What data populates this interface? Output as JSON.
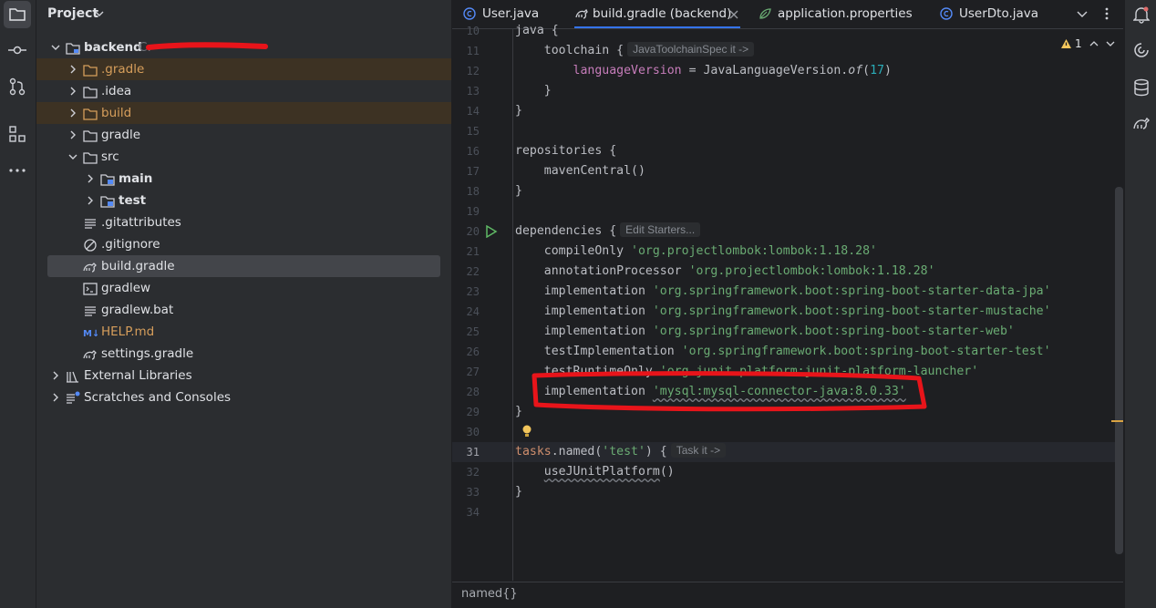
{
  "left_toolbar": {
    "items": [
      "project-icon",
      "commit-icon",
      "git-branch-icon",
      "structure-icon",
      "more-icon"
    ]
  },
  "project_panel": {
    "title": "Project",
    "tree": [
      {
        "label": "backend",
        "path_hint": "C:",
        "level": 0,
        "expanded": true,
        "icon": "module-folder-icon",
        "style": "bold"
      },
      {
        "label": ".gradle",
        "level": 1,
        "expanded": false,
        "icon": "folder-icon",
        "style": "orange"
      },
      {
        "label": ".idea",
        "level": 1,
        "expanded": false,
        "icon": "folder-icon",
        "style": "normal"
      },
      {
        "label": "build",
        "level": 1,
        "expanded": false,
        "icon": "folder-icon",
        "style": "orange"
      },
      {
        "label": "gradle",
        "level": 1,
        "expanded": false,
        "icon": "folder-icon",
        "style": "normal"
      },
      {
        "label": "src",
        "level": 1,
        "expanded": true,
        "icon": "folder-icon",
        "style": "normal"
      },
      {
        "label": "main",
        "level": 2,
        "expanded": false,
        "icon": "source-folder-icon",
        "style": "bold"
      },
      {
        "label": "test",
        "level": 2,
        "expanded": false,
        "icon": "source-folder-icon",
        "style": "bold"
      },
      {
        "label": ".gitattributes",
        "level": 1,
        "icon": "text-file-icon",
        "style": "normal"
      },
      {
        "label": ".gitignore",
        "level": 1,
        "icon": "ignore-file-icon",
        "style": "normal"
      },
      {
        "label": "build.gradle",
        "level": 1,
        "icon": "gradle-icon",
        "style": "normal",
        "selected": true
      },
      {
        "label": "gradlew",
        "level": 1,
        "icon": "shell-icon",
        "style": "normal"
      },
      {
        "label": "gradlew.bat",
        "level": 1,
        "icon": "text-file-icon",
        "style": "normal"
      },
      {
        "label": "HELP.md",
        "level": 1,
        "icon": "markdown-icon",
        "style": "orange"
      },
      {
        "label": "settings.gradle",
        "level": 1,
        "icon": "gradle-icon",
        "style": "normal"
      },
      {
        "label": "External Libraries",
        "level": 0,
        "expanded": false,
        "icon": "library-icon",
        "style": "normal"
      },
      {
        "label": "Scratches and Consoles",
        "level": 0,
        "expanded": false,
        "icon": "scratches-icon",
        "style": "normal"
      }
    ]
  },
  "tabs": [
    {
      "label": "User.java",
      "icon": "class-icon"
    },
    {
      "label": "build.gradle (backend)",
      "icon": "gradle-icon",
      "active": true
    },
    {
      "label": "application.properties",
      "icon": "spring-icon"
    },
    {
      "label": "UserDto.java",
      "icon": "class-icon"
    }
  ],
  "inspection": {
    "warnings": "1"
  },
  "editor": {
    "lines": [
      {
        "n": "10",
        "tokens": [
          {
            "t": "java {",
            "c": "fn"
          }
        ]
      },
      {
        "n": "11",
        "tokens": [
          {
            "t": "    toolchain {",
            "c": "fn"
          },
          {
            "hint": "JavaToolchainSpec it ->"
          }
        ]
      },
      {
        "n": "12",
        "tokens": [
          {
            "t": "        ",
            "c": "fn"
          },
          {
            "t": "languageVersion",
            "c": "prop"
          },
          {
            "t": " = JavaLanguageVersion.",
            "c": "fn"
          },
          {
            "t": "of",
            "c": "fn ital"
          },
          {
            "t": "(",
            "c": "fn"
          },
          {
            "t": "17",
            "c": "num"
          },
          {
            "t": ")",
            "c": "fn"
          }
        ]
      },
      {
        "n": "13",
        "tokens": [
          {
            "t": "    }",
            "c": "fn"
          }
        ]
      },
      {
        "n": "14",
        "tokens": [
          {
            "t": "}",
            "c": "fn"
          }
        ]
      },
      {
        "n": "15",
        "tokens": []
      },
      {
        "n": "16",
        "tokens": [
          {
            "t": "repositories {",
            "c": "fn"
          }
        ]
      },
      {
        "n": "17",
        "tokens": [
          {
            "t": "    mavenCentral()",
            "c": "fn"
          }
        ]
      },
      {
        "n": "18",
        "tokens": [
          {
            "t": "}",
            "c": "fn"
          }
        ]
      },
      {
        "n": "19",
        "tokens": []
      },
      {
        "n": "20",
        "run": true,
        "tokens": [
          {
            "t": "dependencies {",
            "c": "fn"
          },
          {
            "hint": "Edit Starters..."
          }
        ]
      },
      {
        "n": "21",
        "tokens": [
          {
            "t": "    compileOnly ",
            "c": "fn"
          },
          {
            "t": "'org.projectlombok:lombok:1.18.28'",
            "c": "str"
          }
        ]
      },
      {
        "n": "22",
        "tokens": [
          {
            "t": "    annotationProcessor ",
            "c": "fn"
          },
          {
            "t": "'org.projectlombok:lombok:1.18.28'",
            "c": "str"
          }
        ]
      },
      {
        "n": "23",
        "tokens": [
          {
            "t": "    implementation ",
            "c": "fn"
          },
          {
            "t": "'org.springframework.boot:spring-boot-starter-data-jpa'",
            "c": "str"
          }
        ]
      },
      {
        "n": "24",
        "tokens": [
          {
            "t": "    implementation ",
            "c": "fn"
          },
          {
            "t": "'org.springframework.boot:spring-boot-starter-mustache'",
            "c": "str"
          }
        ]
      },
      {
        "n": "25",
        "tokens": [
          {
            "t": "    implementation ",
            "c": "fn"
          },
          {
            "t": "'org.springframework.boot:spring-boot-starter-web'",
            "c": "str"
          }
        ]
      },
      {
        "n": "26",
        "tokens": [
          {
            "t": "    testImplementation ",
            "c": "fn"
          },
          {
            "t": "'org.springframework.boot:spring-boot-starter-test'",
            "c": "str"
          }
        ]
      },
      {
        "n": "27",
        "tokens": [
          {
            "t": "    testRuntimeOnly ",
            "c": "fn"
          },
          {
            "t": "'org.junit.platform:junit-platform-launcher'",
            "c": "str"
          }
        ]
      },
      {
        "n": "28",
        "tokens": [
          {
            "t": "    implementation ",
            "c": "fn"
          },
          {
            "t": "'mysql:mysql-connector-java:8.0.33'",
            "c": "str squiggle"
          }
        ]
      },
      {
        "n": "29",
        "tokens": [
          {
            "t": "}",
            "c": "fn"
          }
        ]
      },
      {
        "n": "30",
        "bulb": true,
        "tokens": []
      },
      {
        "n": "31",
        "current": true,
        "tokens": [
          {
            "t": "tasks",
            "c": "kw"
          },
          {
            "t": ".named(",
            "c": "fn"
          },
          {
            "t": "'test'",
            "c": "str"
          },
          {
            "t": ") {",
            "c": "fn"
          },
          {
            "hint": "Task it ->"
          }
        ]
      },
      {
        "n": "32",
        "tokens": [
          {
            "t": "    ",
            "c": "fn"
          },
          {
            "t": "useJUnitPlatform",
            "c": "fn squiggle"
          },
          {
            "t": "()",
            "c": "fn"
          }
        ]
      },
      {
        "n": "33",
        "tokens": [
          {
            "t": "}",
            "c": "fn"
          }
        ]
      },
      {
        "n": "34",
        "tokens": []
      }
    ]
  },
  "status": {
    "breadcrumb": "named{}"
  },
  "right_toolbar": {
    "items": [
      "notifications-icon",
      "ai-assistant-icon",
      "database-icon",
      "gradle-icon"
    ]
  }
}
